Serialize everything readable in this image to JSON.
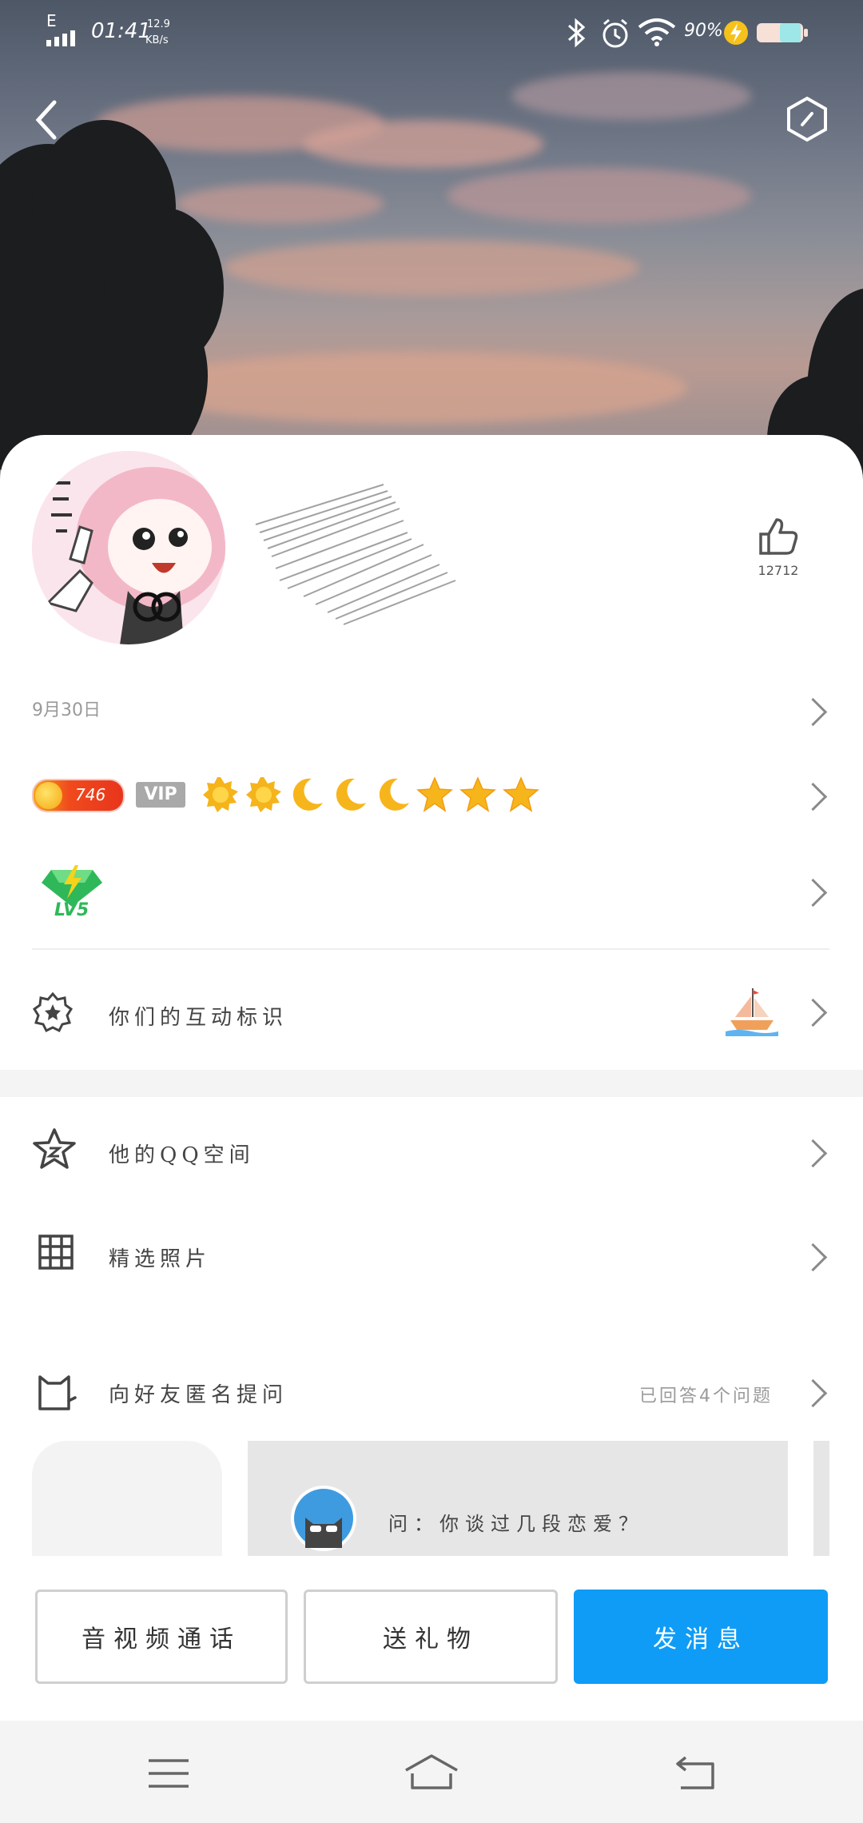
{
  "status_bar": {
    "network": "E",
    "time": "01:41",
    "speed_value": "12.9",
    "speed_unit": "KB/s",
    "battery": "90%"
  },
  "profile": {
    "like_count": "12712",
    "birthday": "9月30日",
    "coin_count": "746",
    "vip_badge": "VIP",
    "level_badge": "LV5"
  },
  "rows": {
    "interaction_label": "你们的互动标识",
    "qzone_label": "他的QQ空间",
    "photos_label": "精选照片",
    "anon_label": "向好友匿名提问",
    "anon_right": "已回答4个问题"
  },
  "question_card": {
    "text": "问：你谈过几段恋爱？"
  },
  "buttons": {
    "video_call": "音视频通话",
    "gift": "送礼物",
    "message": "发消息"
  },
  "colors": {
    "primary": "#0f9cf6",
    "coin_orange": "#f0481e",
    "gold": "#f5b41b"
  }
}
